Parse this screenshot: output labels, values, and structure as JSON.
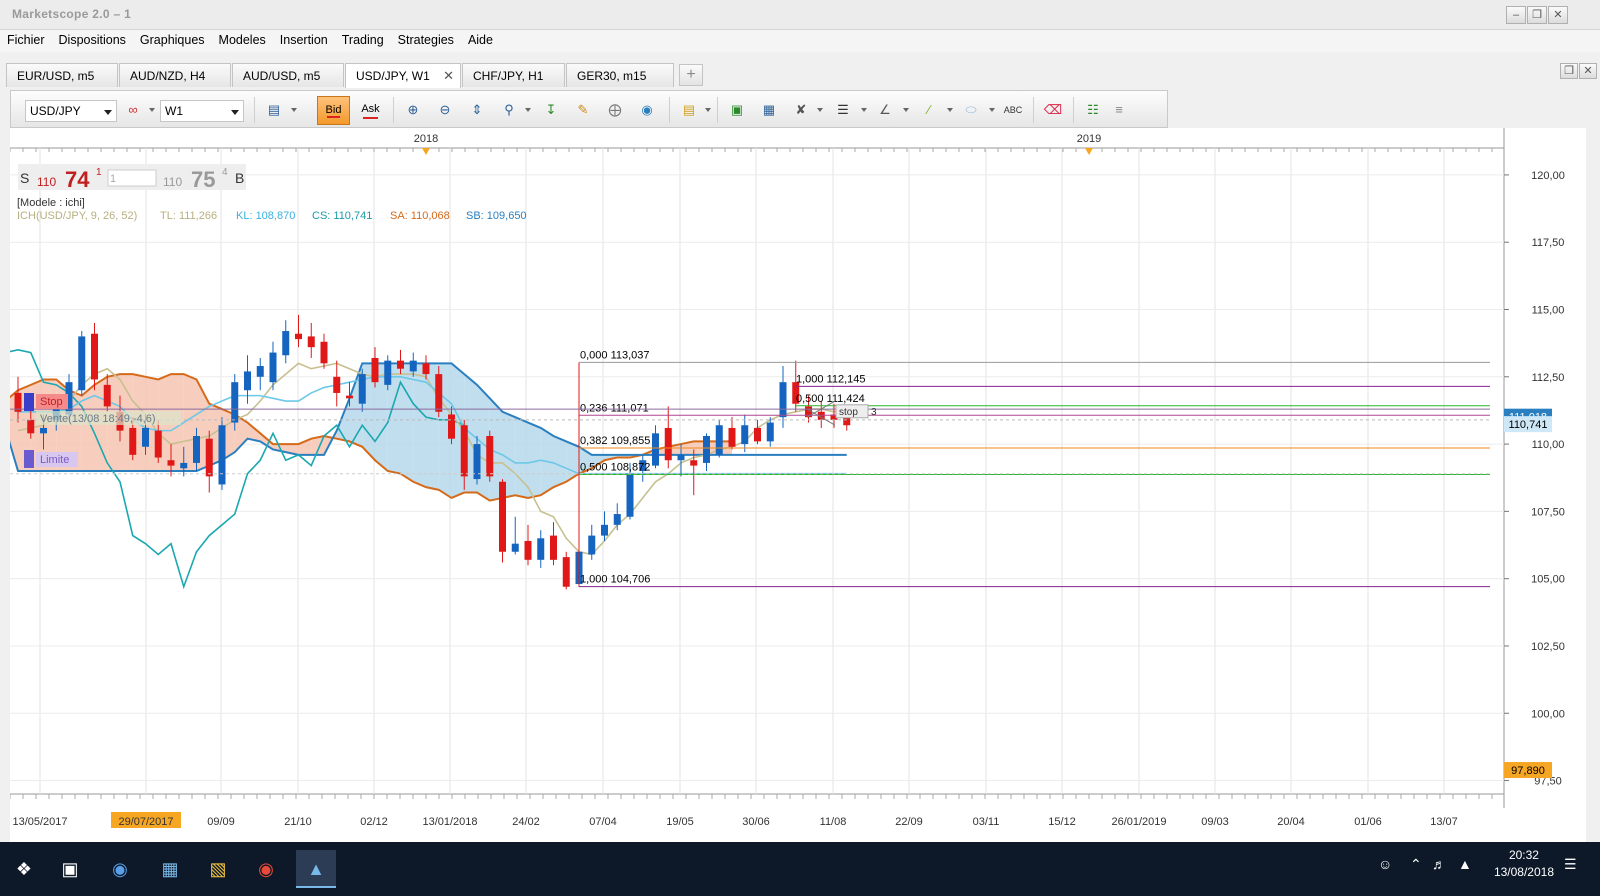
{
  "window": {
    "title": "Marketscope 2.0 – 1"
  },
  "menu": [
    "Fichier",
    "Dispositions",
    "Graphiques",
    "Modeles",
    "Insertion",
    "Trading",
    "Strategies",
    "Aide"
  ],
  "tabs": [
    {
      "label": "EUR/USD, m5"
    },
    {
      "label": "AUD/NZD, H4"
    },
    {
      "label": "AUD/USD, m5"
    },
    {
      "label": "USD/JPY, W1",
      "active": true
    },
    {
      "label": "CHF/JPY, H1"
    },
    {
      "label": "GER30, m15"
    }
  ],
  "toolbar": {
    "symbol": "USD/JPY",
    "timeframe": "W1",
    "bid_label": "Bid",
    "ask_label": "Ask"
  },
  "quote": {
    "sell_label": "S",
    "sell_big": "110",
    "sell_main": "74",
    "sell_sup": "1",
    "amount": "1",
    "buy_big": "110",
    "buy_main": "75",
    "buy_sup": "4",
    "buy_label": "B"
  },
  "chart_info": {
    "model": "[Modele : ichi]",
    "ich_name": "ICH(USD/JPY, 9, 26, 52)",
    "tl": "TL: 111,266",
    "kl": "KL: 108,870",
    "cs": "CS: 110,741",
    "sa": "SA: 110,068",
    "sb": "SB: 109,650"
  },
  "orders": {
    "stop_label": "Stop",
    "vente_label": "Vente(13/08 18:49,-4,6)",
    "limite_label": "Limite",
    "stop_small": "stop",
    "stop_small_suffix": "3"
  },
  "fib_left": [
    {
      "level": "0,000 113,037",
      "price": 113.037
    },
    {
      "level": "0,236 111,071",
      "price": 111.071
    },
    {
      "level": "0,382 109,855",
      "price": 109.855
    },
    {
      "level": "0,500 108,872",
      "price": 108.872
    },
    {
      "level": "1,000 104,706",
      "price": 104.706
    }
  ],
  "fib_right": [
    {
      "level": "1,000 112,145",
      "price": 112.145
    },
    {
      "level": "0,500 111,424",
      "price": 111.424
    }
  ],
  "price_markers": [
    {
      "label": "111,018",
      "price": 111.018,
      "color": "#2a7fc0"
    },
    {
      "label": "110,741",
      "price": 110.741,
      "color": "#cfe8f7"
    },
    {
      "label": "97,890",
      "price": 97.89,
      "color": "#f6a623"
    }
  ],
  "y_axis_labels": [
    "120,00",
    "117,50",
    "115,00",
    "112,50",
    "110,00",
    "107,50",
    "105,00",
    "102,50",
    "100,00",
    "97,50"
  ],
  "x_axis_labels": [
    "13/05/2017",
    "29/07/2017",
    "09/09",
    "21/10",
    "02/12",
    "13/01/2018",
    "24/02",
    "07/04",
    "19/05",
    "30/06",
    "11/08",
    "22/09",
    "03/11",
    "15/12",
    "26/01/2019",
    "09/03",
    "20/04",
    "01/06",
    "13/07"
  ],
  "top_years": [
    "2018",
    "2019"
  ],
  "colors": {
    "bull": "#1565c0",
    "bear": "#e01818",
    "tenkan": "#d46a1a",
    "kijun": "#2a7fc0",
    "chikou": "#1aa8b0",
    "cloud_up": "#b5d8ea",
    "cloud_down": "#f6c4b3",
    "green_line": "#28b628",
    "purple_line": "#8a2090",
    "orange_line": "#f08a1a"
  },
  "taskbar": {
    "time": "20:32",
    "date": "13/08/2018"
  },
  "chart_data": {
    "type": "candlestick",
    "title": "",
    "xlabel": "",
    "ylabel": "",
    "ylim": [
      97.0,
      121.0
    ],
    "candles": [
      {
        "o": 111.9,
        "h": 112.5,
        "l": 110.8,
        "c": 111.2
      },
      {
        "o": 110.9,
        "h": 111.6,
        "l": 110.2,
        "c": 110.4
      },
      {
        "o": 110.4,
        "h": 111.1,
        "l": 109.8,
        "c": 110.6
      },
      {
        "o": 110.9,
        "h": 111.5,
        "l": 110.5,
        "c": 111.3
      },
      {
        "o": 111.1,
        "h": 112.6,
        "l": 110.9,
        "c": 112.3
      },
      {
        "o": 112.0,
        "h": 114.2,
        "l": 111.8,
        "c": 114.0
      },
      {
        "o": 114.1,
        "h": 114.5,
        "l": 112.0,
        "c": 112.4
      },
      {
        "o": 112.2,
        "h": 112.6,
        "l": 111.2,
        "c": 111.4
      },
      {
        "o": 111.2,
        "h": 111.8,
        "l": 110.1,
        "c": 110.5
      },
      {
        "o": 110.6,
        "h": 111.0,
        "l": 109.4,
        "c": 109.6
      },
      {
        "o": 109.9,
        "h": 111.1,
        "l": 109.6,
        "c": 110.6
      },
      {
        "o": 110.5,
        "h": 110.9,
        "l": 109.3,
        "c": 109.5
      },
      {
        "o": 109.4,
        "h": 110.0,
        "l": 108.8,
        "c": 109.2
      },
      {
        "o": 109.1,
        "h": 109.9,
        "l": 108.8,
        "c": 109.3
      },
      {
        "o": 109.3,
        "h": 110.6,
        "l": 109.0,
        "c": 110.3
      },
      {
        "o": 110.2,
        "h": 110.5,
        "l": 108.2,
        "c": 108.8
      },
      {
        "o": 108.5,
        "h": 111.0,
        "l": 108.3,
        "c": 110.7
      },
      {
        "o": 110.8,
        "h": 112.6,
        "l": 110.5,
        "c": 112.3
      },
      {
        "o": 112.0,
        "h": 113.3,
        "l": 111.5,
        "c": 112.7
      },
      {
        "o": 112.5,
        "h": 113.2,
        "l": 112.0,
        "c": 112.9
      },
      {
        "o": 112.3,
        "h": 113.8,
        "l": 112.0,
        "c": 113.4
      },
      {
        "o": 113.3,
        "h": 114.6,
        "l": 113.0,
        "c": 114.2
      },
      {
        "o": 114.1,
        "h": 114.8,
        "l": 113.6,
        "c": 113.9
      },
      {
        "o": 114.0,
        "h": 114.5,
        "l": 113.2,
        "c": 113.6
      },
      {
        "o": 113.8,
        "h": 114.1,
        "l": 112.8,
        "c": 113.0
      },
      {
        "o": 112.5,
        "h": 113.1,
        "l": 111.4,
        "c": 111.9
      },
      {
        "o": 111.8,
        "h": 112.3,
        "l": 111.4,
        "c": 111.7
      },
      {
        "o": 111.5,
        "h": 112.8,
        "l": 111.2,
        "c": 112.6
      },
      {
        "o": 113.2,
        "h": 113.6,
        "l": 112.1,
        "c": 112.3
      },
      {
        "o": 112.2,
        "h": 113.3,
        "l": 112.0,
        "c": 113.1
      },
      {
        "o": 113.1,
        "h": 113.5,
        "l": 112.6,
        "c": 112.8
      },
      {
        "o": 112.7,
        "h": 113.4,
        "l": 112.5,
        "c": 113.1
      },
      {
        "o": 113.0,
        "h": 113.3,
        "l": 112.4,
        "c": 112.6
      },
      {
        "o": 112.6,
        "h": 112.9,
        "l": 111.0,
        "c": 111.2
      },
      {
        "o": 111.1,
        "h": 111.4,
        "l": 110.0,
        "c": 110.2
      },
      {
        "o": 110.7,
        "h": 110.9,
        "l": 108.3,
        "c": 108.8
      },
      {
        "o": 108.7,
        "h": 110.3,
        "l": 108.5,
        "c": 110.0
      },
      {
        "o": 110.3,
        "h": 110.5,
        "l": 108.6,
        "c": 108.8
      },
      {
        "o": 108.6,
        "h": 108.7,
        "l": 105.6,
        "c": 106.0
      },
      {
        "o": 106.0,
        "h": 107.3,
        "l": 105.9,
        "c": 106.3
      },
      {
        "o": 106.4,
        "h": 107.0,
        "l": 105.5,
        "c": 105.7
      },
      {
        "o": 105.7,
        "h": 106.8,
        "l": 105.4,
        "c": 106.5
      },
      {
        "o": 106.6,
        "h": 107.1,
        "l": 105.5,
        "c": 105.7
      },
      {
        "o": 105.8,
        "h": 106.0,
        "l": 104.6,
        "c": 104.7
      },
      {
        "o": 104.8,
        "h": 106.2,
        "l": 104.7,
        "c": 106.0
      },
      {
        "o": 105.9,
        "h": 107.0,
        "l": 105.7,
        "c": 106.6
      },
      {
        "o": 106.6,
        "h": 107.5,
        "l": 106.4,
        "c": 107.0
      },
      {
        "o": 107.0,
        "h": 107.8,
        "l": 106.8,
        "c": 107.4
      },
      {
        "o": 107.3,
        "h": 109.3,
        "l": 107.2,
        "c": 108.9
      },
      {
        "o": 109.0,
        "h": 109.6,
        "l": 108.6,
        "c": 109.4
      },
      {
        "o": 109.2,
        "h": 110.7,
        "l": 109.1,
        "c": 110.4
      },
      {
        "o": 110.6,
        "h": 111.4,
        "l": 109.1,
        "c": 109.4
      },
      {
        "o": 109.4,
        "h": 110.0,
        "l": 108.8,
        "c": 109.6
      },
      {
        "o": 109.4,
        "h": 109.8,
        "l": 108.1,
        "c": 109.2
      },
      {
        "o": 109.3,
        "h": 110.4,
        "l": 109.0,
        "c": 110.3
      },
      {
        "o": 109.6,
        "h": 110.9,
        "l": 109.5,
        "c": 110.7
      },
      {
        "o": 110.6,
        "h": 111.0,
        "l": 109.8,
        "c": 109.9
      },
      {
        "o": 110.0,
        "h": 111.1,
        "l": 109.7,
        "c": 110.7
      },
      {
        "o": 110.6,
        "h": 110.9,
        "l": 110.0,
        "c": 110.1
      },
      {
        "o": 110.1,
        "h": 111.0,
        "l": 109.9,
        "c": 110.8
      },
      {
        "o": 111.0,
        "h": 112.9,
        "l": 110.6,
        "c": 112.3
      },
      {
        "o": 112.3,
        "h": 113.1,
        "l": 111.2,
        "c": 111.5
      },
      {
        "o": 111.4,
        "h": 111.8,
        "l": 110.8,
        "c": 111.0
      },
      {
        "o": 111.2,
        "h": 111.6,
        "l": 110.6,
        "c": 110.9
      },
      {
        "o": 111.1,
        "h": 111.5,
        "l": 110.6,
        "c": 110.9
      },
      {
        "o": 111.3,
        "h": 111.4,
        "l": 110.5,
        "c": 110.7
      }
    ],
    "tenkan": [
      110.5,
      110.6,
      110.7,
      111.0,
      111.6,
      112.2,
      112.6,
      112.8,
      112.4,
      111.6,
      111.1,
      110.4,
      110.0,
      110.1,
      110.2,
      110.3,
      110.6,
      110.9,
      111.1,
      111.6,
      112.2,
      112.6,
      113.0,
      112.8,
      112.9,
      113.0,
      112.8,
      112.6,
      112.5,
      112.6,
      112.6,
      112.6,
      112.5,
      111.7,
      111.1,
      110.5,
      109.6,
      109.3,
      109.3,
      108.9,
      108.4,
      107.5,
      107.3,
      106.5,
      106.0,
      105.9,
      106.4,
      107.0,
      107.4,
      108.0,
      108.6,
      108.9,
      109.3,
      109.5,
      109.6,
      109.8,
      109.9,
      110.1,
      110.6,
      110.9,
      111.1,
      111.2,
      111.3,
      111.3,
      111.2,
      111.3
    ],
    "kijun": [
      111.2,
      111.2,
      111.2,
      111.2,
      111.3,
      111.6,
      111.8,
      111.6,
      111.4,
      110.9,
      110.6,
      110.5,
      110.5,
      110.8,
      111.1,
      111.4,
      111.6,
      111.8,
      111.8,
      111.8,
      111.7,
      111.6,
      111.6,
      111.9,
      112.1,
      112.2,
      112.3,
      112.4,
      112.5,
      112.5,
      112.5,
      112.4,
      112.3,
      111.9,
      111.5,
      110.6,
      110.2,
      109.8,
      109.6,
      109.3,
      109.3,
      109.4,
      109.3,
      109.1,
      108.9,
      108.9,
      108.9,
      108.9,
      108.9,
      108.9,
      108.9,
      108.9,
      108.9,
      108.9,
      108.9,
      108.9,
      108.9,
      108.9,
      108.9,
      108.9,
      108.9,
      108.9,
      108.9,
      108.9,
      108.9,
      108.9
    ],
    "chikou": [
      113.4,
      113.4,
      113.5,
      113.4,
      112.3,
      112.2,
      111.9,
      111.4,
      110.4,
      109.3,
      108.6,
      106.6,
      106.3,
      105.9,
      106.3,
      104.7,
      106.0,
      106.6,
      107.0,
      107.4,
      108.9,
      109.4,
      110.4,
      109.4,
      109.6,
      109.2,
      110.3,
      110.7,
      109.9,
      110.7,
      110.1,
      110.8,
      112.3,
      111.5,
      111.0,
      110.9,
      110.9,
      110.7
    ],
    "senkou_a": [
      105.7,
      107.0,
      107.6,
      108.8,
      109.9,
      110.0,
      110.1,
      110.5,
      110.7,
      110.9,
      111.0,
      111.4,
      111.9,
      112.3,
      112.0,
      111.6,
      111.5,
      111.2,
      111.2,
      111.2,
      111.1,
      111.0,
      111.2,
      111.2,
      111.4,
      111.6,
      112.0,
      112.2,
      112.4,
      112.4,
      112.0,
      111.8,
      112.2,
      112.5,
      112.6,
      112.6,
      112.5,
      112.4,
      112.6,
      112.6,
      112.4,
      111.5,
      111.3,
      111.1,
      110.8,
      110.4,
      110.0,
      110.0,
      110.0,
      110.2,
      110.3,
      110.2,
      110.1,
      109.9,
      109.4,
      109.0,
      108.9,
      108.6,
      108.4,
      108.3,
      108.0,
      108.2,
      108.2,
      107.9,
      108.0,
      108.1,
      108.0,
      108.1,
      108.4,
      108.6,
      108.9,
      109.1,
      109.4,
      109.5,
      109.5,
      109.6,
      109.8,
      109.9,
      110.0,
      110.1,
      110.1,
      110.1,
      110.1
    ],
    "senkou_b": [
      113.5,
      113.5,
      113.5,
      113.5,
      113.4,
      113.4,
      113.2,
      112.8,
      111.6,
      111.6,
      111.6,
      111.6,
      111.6,
      111.4,
      111.3,
      111.1,
      111.0,
      111.1,
      110.2,
      110.2,
      110.2,
      110.2,
      110.3,
      110.7,
      111.2,
      110.6,
      109.0,
      109.0,
      109.0,
      109.0,
      109.0,
      109.0,
      109.0,
      109.0,
      109.0,
      109.0,
      109.0,
      109.0,
      109.0,
      109.0,
      109.0,
      109.2,
      109.4,
      109.7,
      110.2,
      110.1,
      109.8,
      109.7,
      109.6,
      109.6,
      109.6,
      110.5,
      111.7,
      113.0,
      113.0,
      113.0,
      113.0,
      113.0,
      113.0,
      113.0,
      113.0,
      112.6,
      112.2,
      111.7,
      111.2,
      111.0,
      110.8,
      110.6,
      110.3,
      110.1,
      109.9,
      109.6,
      109.6,
      109.6,
      109.6,
      109.6,
      109.6,
      109.6,
      109.6,
      109.6,
      109.6,
      109.6,
      109.6,
      109.6,
      109.6,
      109.6,
      109.6,
      109.6,
      109.6,
      109.6,
      109.6,
      109.6
    ]
  }
}
